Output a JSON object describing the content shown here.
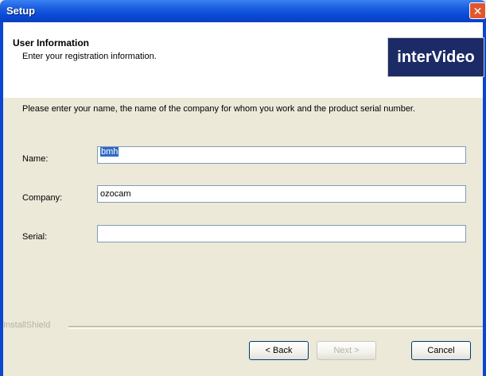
{
  "window": {
    "title": "Setup",
    "close_glyph": "✕"
  },
  "header": {
    "title": "User Information",
    "subtitle": "Enter your registration information.",
    "logo_text": "interVideo"
  },
  "description": "Please enter your name, the name of the company for whom you work and the product serial number.",
  "fields": {
    "name": {
      "label": "Name:",
      "value": "bmh"
    },
    "company": {
      "label": "Company:",
      "value": "ozocam"
    },
    "serial": {
      "label": "Serial:",
      "value": ""
    }
  },
  "footer": {
    "brand": "InstallShield",
    "back_label": "< Back",
    "next_label": "Next >",
    "cancel_label": "Cancel"
  },
  "colors": {
    "titlebar": "#0a49d6",
    "accent": "#316ac5",
    "dialog_bg": "#ece9d8"
  },
  "icons": {
    "close": "close-icon"
  }
}
